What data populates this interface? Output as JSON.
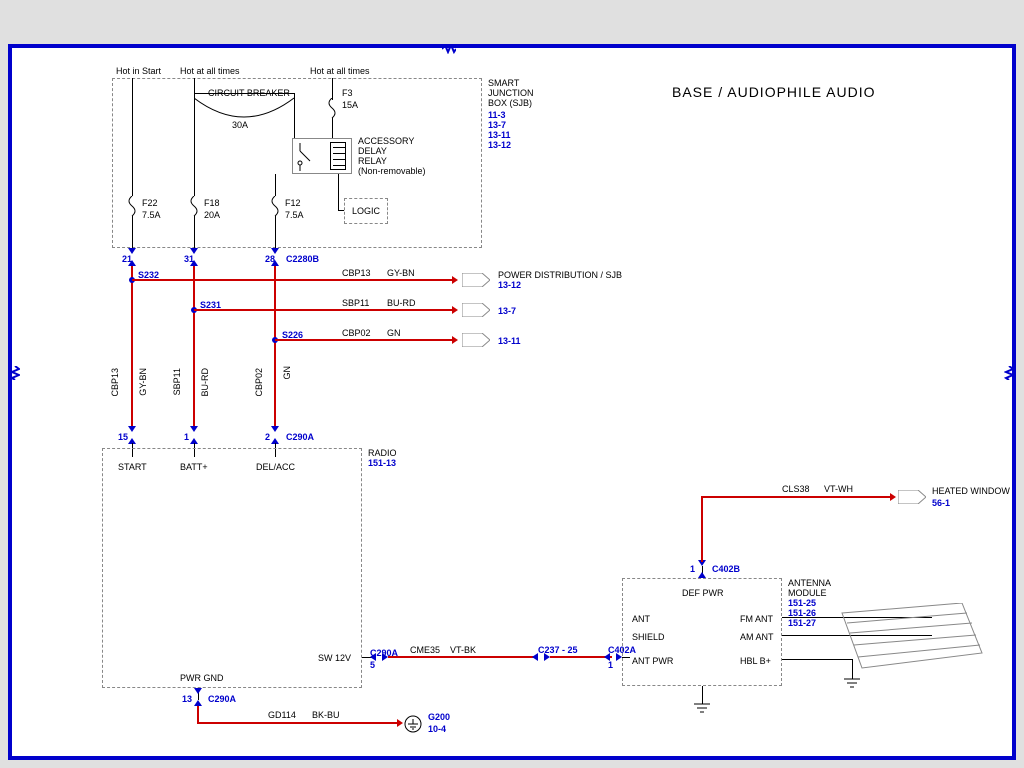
{
  "title": "BASE / AUDIOPHILE AUDIO",
  "sjb": {
    "label1": "SMART",
    "label2": "JUNCTION",
    "label3": "BOX (SJB)",
    "refs": [
      "11-3",
      "13-7",
      "13-11",
      "13-12"
    ],
    "hot1": "Hot in Start",
    "hot2": "Hot at all times",
    "hot3": "Hot at all times",
    "cb": "CIRCUIT BREAKER",
    "cb_amp": "30A",
    "f3": "F3",
    "f3_amp": "15A",
    "relay1": "ACCESSORY",
    "relay2": "DELAY",
    "relay3": "RELAY",
    "relay4": "(Non-removable)",
    "logic": "LOGIC",
    "f22": "F22",
    "f22_amp": "7.5A",
    "f18": "F18",
    "f18_amp": "20A",
    "f12": "F12",
    "f12_amp": "7.5A"
  },
  "conn1": {
    "pin21": "21",
    "pin31": "31",
    "pin28": "28",
    "name": "C2280B"
  },
  "splices": {
    "s232": "S232",
    "s231": "S231",
    "s226": "S226"
  },
  "wires": {
    "cbp13": "CBP13",
    "cbp13_c": "GY-BN",
    "sbp11": "SBP11",
    "sbp11_c": "BU-RD",
    "cbp02": "CBP02",
    "cbp02_c": "GN",
    "gyBn": "GY-BN",
    "buRd": "BU-RD",
    "gn": "GN",
    "cme35": "CME35",
    "cme35_c": "VT-BK",
    "cls38": "CLS38",
    "cls38_c": "VT-WH",
    "gd114": "GD114",
    "gd114_c": "BK-BU"
  },
  "dist": {
    "label": "POWER DISTRIBUTION / SJB",
    "r1": "13-12",
    "r2": "13-7",
    "r3": "13-11"
  },
  "conn2": {
    "pin15": "15",
    "pin1": "1",
    "pin2": "2",
    "name": "C290A"
  },
  "radio": {
    "name": "RADIO",
    "ref": "151-13",
    "start": "START",
    "batt": "BATT+",
    "delacc": "DEL/ACC",
    "gnd": "PWR GND",
    "sw12": "SW 12V"
  },
  "conn3": {
    "pin13": "13",
    "pin5": "5",
    "name": "C290A"
  },
  "g200": {
    "name": "G200",
    "ref": "10-4"
  },
  "connC237": "C237 - 25",
  "connC402A": "C402A",
  "connC402B": {
    "pin1": "1",
    "name": "C402B"
  },
  "antmod": {
    "name": "ANTENNA",
    "name2": "MODULE",
    "refs": [
      "151-25",
      "151-26",
      "151-27"
    ],
    "defpwr": "DEF PWR",
    "ant": "ANT",
    "fmant": "FM ANT",
    "shield": "SHIELD",
    "amant": "AM ANT",
    "antpwr": "ANT PWR",
    "hbl": "HBL B+"
  },
  "heated": {
    "label": "HEATED WINDOW",
    "ref": "56-1"
  }
}
